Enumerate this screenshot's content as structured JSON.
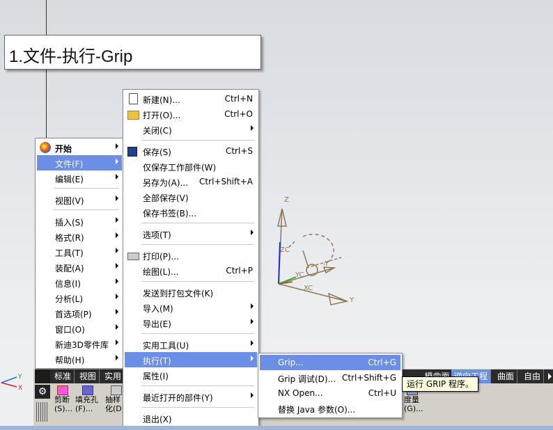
{
  "note": {
    "title": "1.文件-执行-Grip"
  },
  "main_menu": {
    "items": [
      {
        "label": "开始",
        "bold": true,
        "icon": "nx-start-icon"
      },
      {
        "label": "文件(F)",
        "highlight": true
      },
      {
        "label": "编辑(E)"
      },
      {
        "label": "视图(V)"
      },
      {
        "label": "插入(S)"
      },
      {
        "label": "格式(R)"
      },
      {
        "label": "工具(T)"
      },
      {
        "label": "装配(A)"
      },
      {
        "label": "信息(I)"
      },
      {
        "label": "分析(L)"
      },
      {
        "label": "首选项(P)"
      },
      {
        "label": "窗口(O)"
      },
      {
        "label": "新迪3D零件库"
      },
      {
        "label": "帮助(H)"
      }
    ]
  },
  "file_menu": {
    "items": [
      {
        "label": "新建(N)...",
        "shortcut": "Ctrl+N",
        "icon": "new-file-icon"
      },
      {
        "label": "打开(O)...",
        "shortcut": "Ctrl+O",
        "icon": "open-folder-icon"
      },
      {
        "label": "关闭(C)",
        "submenu": true
      },
      {
        "label": "保存(S)",
        "shortcut": "Ctrl+S",
        "icon": "save-icon"
      },
      {
        "label": "仅保存工作部件(W)"
      },
      {
        "label": "另存为(A)...",
        "shortcut": "Ctrl+Shift+A"
      },
      {
        "label": "全部保存(V)"
      },
      {
        "label": "保存书签(B)..."
      },
      {
        "label": "选项(T)",
        "submenu": true
      },
      {
        "label": "打印(P)...",
        "icon": "printer-icon"
      },
      {
        "label": "绘图(L)...",
        "shortcut": "Ctrl+P"
      },
      {
        "label": "发送到打包文件(K)"
      },
      {
        "label": "导入(M)",
        "submenu": true
      },
      {
        "label": "导出(E)",
        "submenu": true
      },
      {
        "label": "实用工具(U)",
        "submenu": true
      },
      {
        "label": "执行(T)",
        "submenu": true,
        "highlight": true
      },
      {
        "label": "属性(I)"
      },
      {
        "label": "最近打开的部件(Y)",
        "submenu": true
      },
      {
        "label": "退出(X)"
      }
    ]
  },
  "execute_menu": {
    "items": [
      {
        "label": "Grip...",
        "shortcut": "Ctrl+G",
        "highlight": true
      },
      {
        "label": "Grip 调试(D)...",
        "shortcut": "Ctrl+Shift+G"
      },
      {
        "label": "NX Open...",
        "shortcut": "Ctrl+U"
      },
      {
        "label": "替换 Java 参数(O)..."
      }
    ]
  },
  "tooltip": "运行 GRIP 程序。",
  "toolbar": {
    "tabs": [
      "标准",
      "视图",
      "实用",
      "逆向工程",
      "曲面",
      "自由"
    ],
    "partial_tab": "...模曲面",
    "buttons": [
      {
        "label": "剪断\n(S)...",
        "icon": "trim-icon"
      },
      {
        "label": "填充孔\n(F)...",
        "icon": "fill-hole-icon"
      },
      {
        "label": "抽样\n化(D)",
        "icon": "sample-icon"
      },
      {
        "label": "度量\n(G)...",
        "icon": "measure-icon"
      }
    ]
  },
  "axes": {
    "z": "Z",
    "zc": "ZC",
    "yc": "YC",
    "xc": "XC",
    "y": "Y",
    "y2": "Y"
  },
  "corner_axes": {
    "x": "X",
    "y": "Y"
  },
  "colors": {
    "highlight": "#6b8fe6",
    "menu_bg": "#ffffff",
    "tooltip_bg": "#ffffe1",
    "toolbar_dark": "#2b2b2b",
    "axis_color": "#8b7a4f"
  }
}
